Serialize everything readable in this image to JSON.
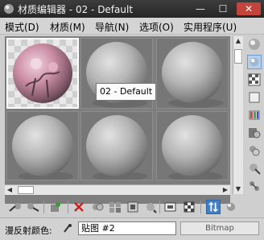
{
  "window": {
    "title": "材质编辑器 - 02 - Default",
    "minimize_glyph": "—",
    "maximize_glyph": "☐",
    "close_glyph": "✕"
  },
  "menubar": {
    "items": [
      {
        "label": "模式(D)"
      },
      {
        "label": "材质(M)"
      },
      {
        "label": "导航(N)"
      },
      {
        "label": "选项(O)"
      },
      {
        "label": "实用程序(U)"
      }
    ]
  },
  "slots": {
    "count": 6,
    "active_index": 0,
    "tooltip": "02 - Default"
  },
  "bottom": {
    "property_label": "漫反射颜色:",
    "map_name": "贴图 #2",
    "map_type": "Bitmap"
  },
  "colors": {
    "accent_selected": "#3f7fc8",
    "title_bar": "#2f2f2f",
    "close_button": "#c3443a",
    "sample_background": "#777777",
    "sphere_gray": "#b5b5b5",
    "sphere_pink": "#cc9aab"
  },
  "icons": {
    "sidebar": [
      "sample-type-icon",
      "backlight-icon",
      "background-checker-icon",
      "sample-uv-tiling-icon",
      "video-color-check-icon",
      "make-preview-icon",
      "options-icon",
      "select-by-material-icon",
      "material-map-navigator-icon"
    ],
    "toolbar": [
      "get-material-icon",
      "put-to-scene-icon",
      "assign-to-selection-icon",
      "reset-map-icon",
      "make-unique-icon",
      "put-to-library-icon",
      "material-id-channel-icon",
      "show-map-in-viewport-icon",
      "show-end-result-icon",
      "go-to-parent-icon",
      "go-forward-to-sibling-icon"
    ]
  }
}
